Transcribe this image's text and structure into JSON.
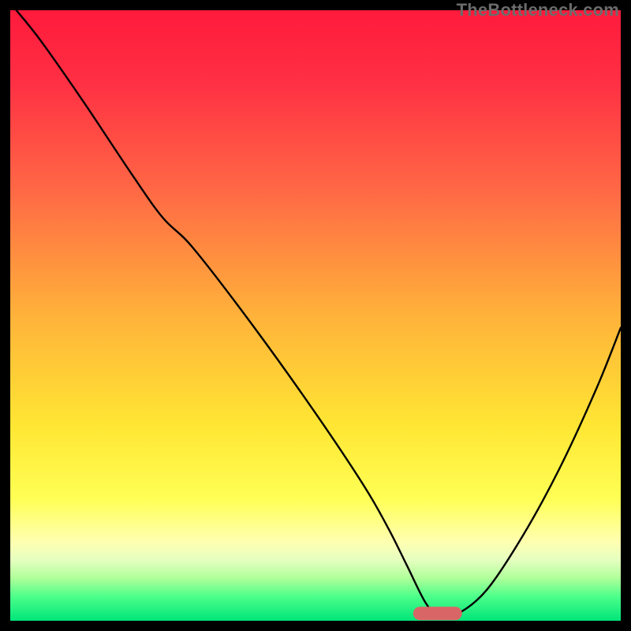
{
  "watermark": "TheBottleneck.com",
  "chart_data": {
    "type": "line",
    "title": "",
    "xlabel": "",
    "ylabel": "",
    "xlim": [
      0,
      100
    ],
    "ylim": [
      0,
      100
    ],
    "grid": false,
    "background_gradient": {
      "stops": [
        {
          "offset": 0.0,
          "color": "#ff1a3c"
        },
        {
          "offset": 0.12,
          "color": "#ff3044"
        },
        {
          "offset": 0.3,
          "color": "#ff6a45"
        },
        {
          "offset": 0.5,
          "color": "#ffb23a"
        },
        {
          "offset": 0.68,
          "color": "#ffe633"
        },
        {
          "offset": 0.8,
          "color": "#ffff55"
        },
        {
          "offset": 0.87,
          "color": "#ffffb0"
        },
        {
          "offset": 0.9,
          "color": "#e6ffc0"
        },
        {
          "offset": 0.93,
          "color": "#b0ff9a"
        },
        {
          "offset": 0.96,
          "color": "#4dff8a"
        },
        {
          "offset": 1.0,
          "color": "#00e57a"
        }
      ]
    },
    "series": [
      {
        "name": "bottleneck-curve",
        "color": "#000000",
        "width": 2.4,
        "x": [
          1,
          5,
          12,
          20,
          25,
          30,
          40,
          50,
          58,
          62,
          65,
          68,
          70,
          73,
          78,
          84,
          90,
          96,
          100
        ],
        "y": [
          100,
          95,
          85,
          73,
          66,
          61,
          48,
          34,
          22,
          15,
          9,
          3,
          1,
          1,
          5,
          14,
          25,
          38,
          48
        ]
      }
    ],
    "marker": {
      "name": "optimal-range",
      "shape": "capsule",
      "color": "#d96666",
      "x_center": 70,
      "y_center": 1.2,
      "width": 8,
      "height": 2.2
    }
  }
}
